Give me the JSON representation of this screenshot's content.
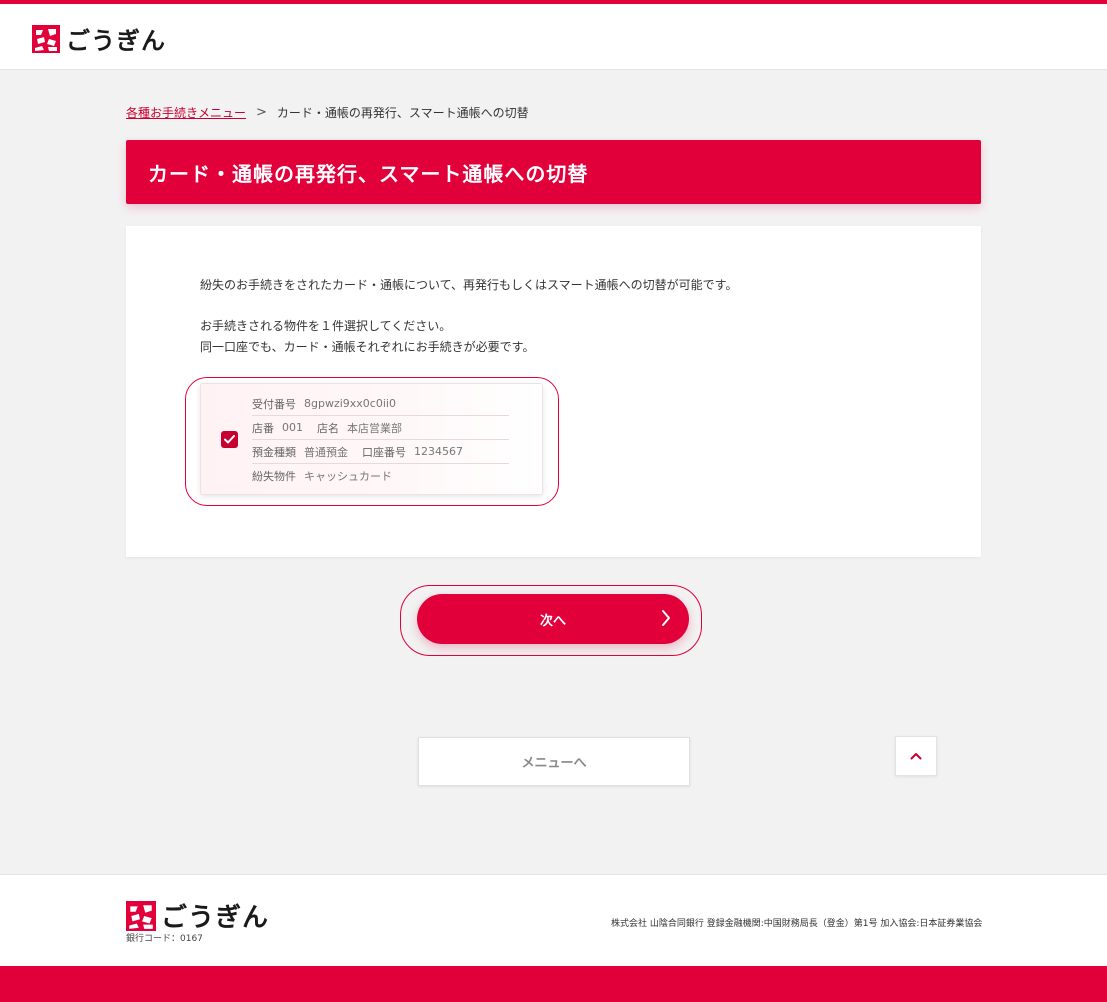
{
  "brand": {
    "name": "ごうぎん",
    "color": "#e2003b"
  },
  "breadcrumb": {
    "parent_label": "各種お手続きメニュー",
    "separator": ">",
    "current_label": "カード・通帳の再発行、スマート通帳への切替"
  },
  "page_title": "カード・通帳の再発行、スマート通帳への切替",
  "content": {
    "intro": "紛失のお手続きをされたカード・通帳について、再発行もしくはスマート通帳への切替が可能です。",
    "instruction_1": "お手続きされる物件を１件選択してください。",
    "instruction_2": "同一口座でも、カード・通帳それぞれにお手続きが必要です。"
  },
  "selection": {
    "checked": true,
    "receipt_label": "受付番号",
    "receipt_value": "8gpwzi9xx0c0ii0",
    "branch_no_label": "店番",
    "branch_no_value": "001",
    "branch_name_label": "店名",
    "branch_name_value": "本店営業部",
    "account_type_label": "預金種類",
    "account_type_value": "普通預金",
    "account_no_label": "口座番号",
    "account_no_value": "1234567",
    "lost_item_label": "紛失物件",
    "lost_item_value": "キャッシュカード"
  },
  "actions": {
    "next_label": "次へ",
    "menu_label": "メニューへ"
  },
  "footer": {
    "bank_code": "銀行コード：0167",
    "company_info": "株式会社 山陰合同銀行 登録金融機関:中国財務局長（登金）第1号 加入協会:日本証券業協会"
  },
  "icons": {
    "logo": "gougin-logo-icon",
    "checkbox": "checkmark-icon",
    "next": "chevron-right-icon",
    "page_top": "chevron-up-icon"
  }
}
